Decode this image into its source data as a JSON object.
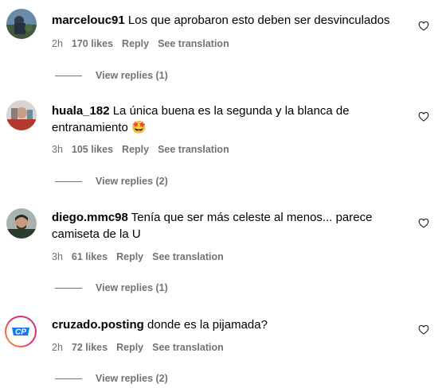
{
  "comments": [
    {
      "username": "marcelouc91",
      "text": "Los que aprobaron esto deben ser desvinculados",
      "time": "2h",
      "likes": "170 likes",
      "reply": "Reply",
      "translate": "See translation",
      "view_replies": "View replies (1)",
      "avatar_icon": "photo-avatar"
    },
    {
      "username": "huala_182",
      "text": "La única buena es la segunda y la blanca de entranamiento 🤩",
      "time": "3h",
      "likes": "105 likes",
      "reply": "Reply",
      "translate": "See translation",
      "view_replies": "View replies (2)",
      "avatar_icon": "photo-avatar"
    },
    {
      "username": "diego.mmc98",
      "text": "Tenía que ser más celeste al menos... parece camiseta de la U",
      "time": "3h",
      "likes": "61 likes",
      "reply": "Reply",
      "translate": "See translation",
      "view_replies": "View replies (1)",
      "avatar_icon": "photo-avatar"
    },
    {
      "username": "cruzado.posting",
      "text": "donde es la pijamada?",
      "time": "2h",
      "likes": "72 likes",
      "reply": "Reply",
      "translate": "See translation",
      "view_replies": "View replies (2)",
      "avatar_icon": "logo-avatar",
      "avatar_logo_text": "CP"
    }
  ],
  "colors": {
    "meta_gray": "#737373",
    "text": "#000000",
    "logo_blue": "#1877f2",
    "logo_ring": "#e1306c"
  },
  "icons": {
    "like": "heart-outline-icon"
  }
}
